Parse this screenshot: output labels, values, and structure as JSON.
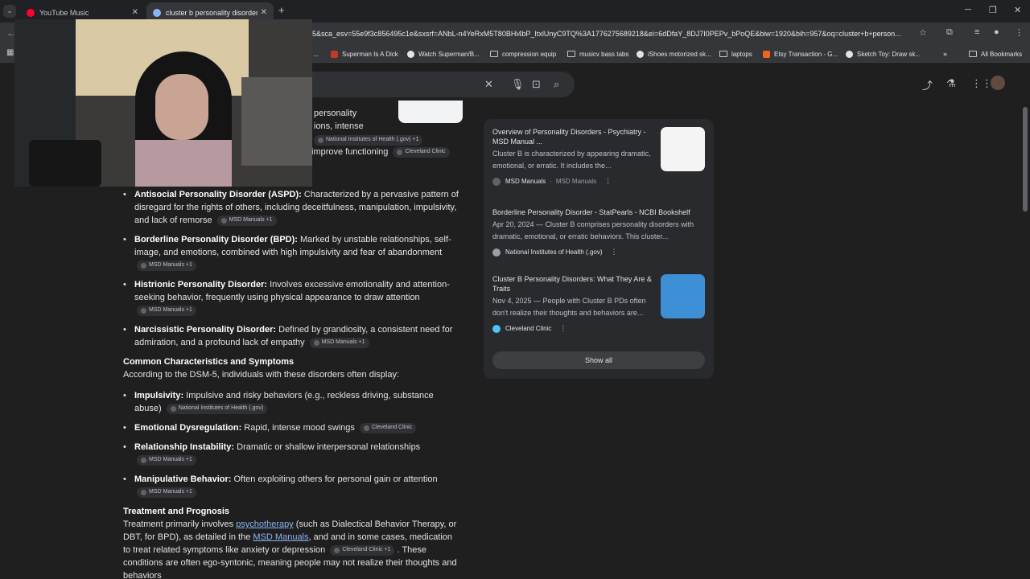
{
  "tabs": [
    {
      "title": "YouTube Music",
      "active": false,
      "favicon_color": "#ff0033"
    },
    {
      "title": "cluster b personality disorders",
      "active": true,
      "favicon_color": "#8ab4f8"
    }
  ],
  "url": "5&sca_esv=55e9f3c856495c1e&sxsrf=ANbL-n4YeRxM5T80BHi4bP_ItxlUnyC9TQ%3A1776275689218&ei=6dDfaY_8DJ7I0PEPv_bPoQE&biw=1920&bih=957&oq=cluster+b+person...",
  "bookmarks": [
    {
      "label": "...",
      "icon": "generic",
      "icon_color": "#9aa0a6"
    },
    {
      "label": "Superman Is A Dick",
      "icon": "image",
      "icon_color": "#c0392b"
    },
    {
      "label": "Watch Superman/B...",
      "icon": "globe",
      "icon_color": "#e3e3e3"
    },
    {
      "label": "compression equip",
      "icon": "folder"
    },
    {
      "label": "musicv bass tabs",
      "icon": "folder"
    },
    {
      "label": "iShoes motorized sk...",
      "icon": "globe",
      "icon_color": "#e3e3e3"
    },
    {
      "label": "laptops",
      "icon": "folder"
    },
    {
      "label": "Etsy Transaction - G...",
      "icon": "etsy",
      "icon_color": "#f1641e"
    },
    {
      "label": "Sketch Toy: Draw sk...",
      "icon": "globe",
      "icon_color": "#e3e3e3"
    }
  ],
  "all_bookmarks": "All Bookmarks",
  "snippet": {
    "line1": "personality",
    "line2": "ions, intense",
    "cite1": "National Institutes of Health (.gov) +1",
    "line3": "improve functioning",
    "cite2": "Cleveland Clinic"
  },
  "types": [
    {
      "name": "Antisocial Personality Disorder (ASPD):",
      "text": " Characterized by a pervasive pattern of disregard for the rights of others, including deceitfulness, manipulation, impulsivity, and lack of remorse",
      "cite": "MSD Manuals +1"
    },
    {
      "name": "Borderline Personality Disorder (BPD):",
      "text": " Marked by unstable relationships, self-image, and emotions, combined with high impulsivity and fear of abandonment",
      "cite": "MSD Manuals +1"
    },
    {
      "name": "Histrionic Personality Disorder:",
      "text": " Involves excessive emotionality and attention-seeking behavior, frequently using physical appearance to draw attention",
      "cite": "MSD Manuals +1"
    },
    {
      "name": "Narcissistic Personality Disorder:",
      "text": " Defined by grandiosity, a consistent need for admiration, and a profound lack of empathy",
      "cite": "MSD Manuals +1"
    }
  ],
  "characteristics": {
    "heading": "Common Characteristics and Symptoms",
    "intro": "According to the DSM-5, individuals with these disorders often display:",
    "items": [
      {
        "name": "Impulsivity:",
        "text": " Impulsive and risky behaviors (e.g., reckless driving, substance abuse)",
        "cite": "National Institutes of Health (.gov)"
      },
      {
        "name": "Emotional Dysregulation:",
        "text": " Rapid, intense mood swings",
        "cite": "Cleveland Clinic"
      },
      {
        "name": "Relationship Instability:",
        "text": " Dramatic or shallow interpersonal relationships",
        "cite": "MSD Manuals +1"
      },
      {
        "name": "Manipulative Behavior:",
        "text": " Often exploiting others for personal gain or attention",
        "cite": "MSD Manuals +1"
      }
    ]
  },
  "treatment": {
    "heading": "Treatment and Prognosis",
    "t1": "Treatment primarily involves ",
    "link1": "psychotherapy",
    "t2": " (such as Dialectical Behavior Therapy, or DBT, for BPD), as detailed in the ",
    "link2": "MSD Manuals",
    "t3": ", and and in some cases, medication to treat related symptoms like anxiety or depression",
    "cite": "Cleveland Clinic +1",
    "t4": ". These conditions are often ego-syntonic, meaning people may not realize their thoughts and behaviors"
  },
  "sources": [
    {
      "title": "Overview of Personality Disorders - Psychiatry - MSD Manual ...",
      "snippet": "Cluster B is characterized by appearing dramatic, emotional, or erratic. It includes the...",
      "source": "MSD Manuals",
      "source2": "MSD Manuals",
      "favicon_color": "#5f6368"
    },
    {
      "title": "Borderline Personality Disorder - StatPearls - NCBI Bookshelf",
      "snippet": "Apr 20, 2024 — Cluster B comprises personality disorders with dramatic, emotional, or erratic behaviors. This cluster...",
      "source": "National Institutes of Health (.gov)",
      "favicon_color": "#9aa0a6"
    },
    {
      "title": "Cluster B Personality Disorders: What They Are & Traits",
      "snippet": "Nov 4, 2025 — People with Cluster B PDs often don't realize their thoughts and behaviors are...",
      "source": "Cleveland Clinic",
      "favicon_color": "#4fc3f7"
    }
  ],
  "show_all": "Show all",
  "colors": {
    "page_bg": "#1f1f1f",
    "link": "#8ab4f8",
    "panel": "#282a2d"
  }
}
